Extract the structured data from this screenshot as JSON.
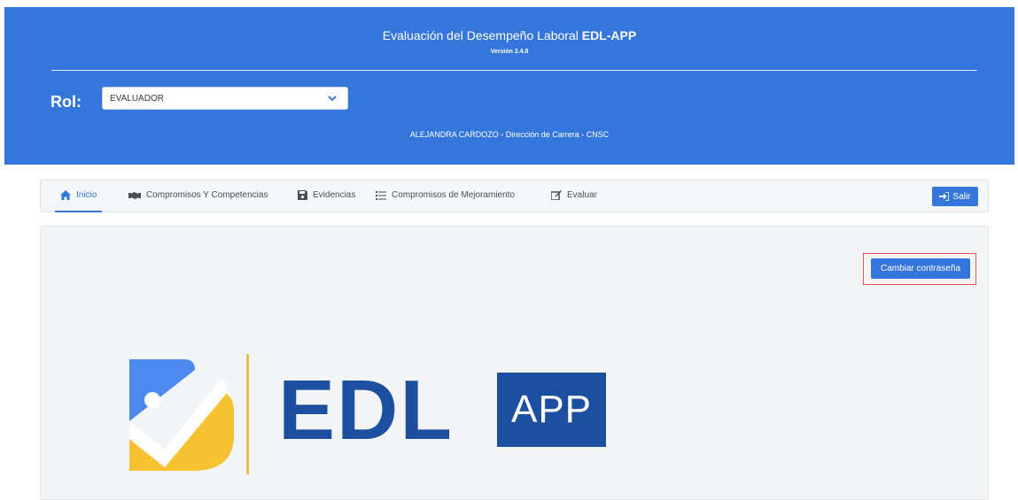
{
  "header": {
    "title_prefix": "Evaluación del Desempeño Laboral",
    "title_app": "EDL-APP",
    "version": "Versión 2.4.8",
    "role_label": "Rol:",
    "role_value": "EVALUADOR",
    "user_info": "ALEJANDRA CARDOZO - Dirección de Carrera - CNSC"
  },
  "nav": {
    "items": [
      {
        "label": "Inicio",
        "icon": "home-icon",
        "active": true
      },
      {
        "label": "Compromisos Y Competencias",
        "icon": "handshake-icon"
      },
      {
        "label": "Evidencias",
        "icon": "save-icon"
      },
      {
        "label": "Compromisos de Mejoramiento",
        "icon": "list-icon"
      },
      {
        "label": "Evaluar",
        "icon": "edit-icon"
      }
    ],
    "logout_label": "Salir"
  },
  "main": {
    "change_password_label": "Cambiar contraseña",
    "logo_edl": "EDL",
    "logo_app": "APP"
  },
  "colors": {
    "primary": "#3576dc",
    "logo_blue": "#1c4fa0",
    "logo_yellow": "#f6c232"
  }
}
